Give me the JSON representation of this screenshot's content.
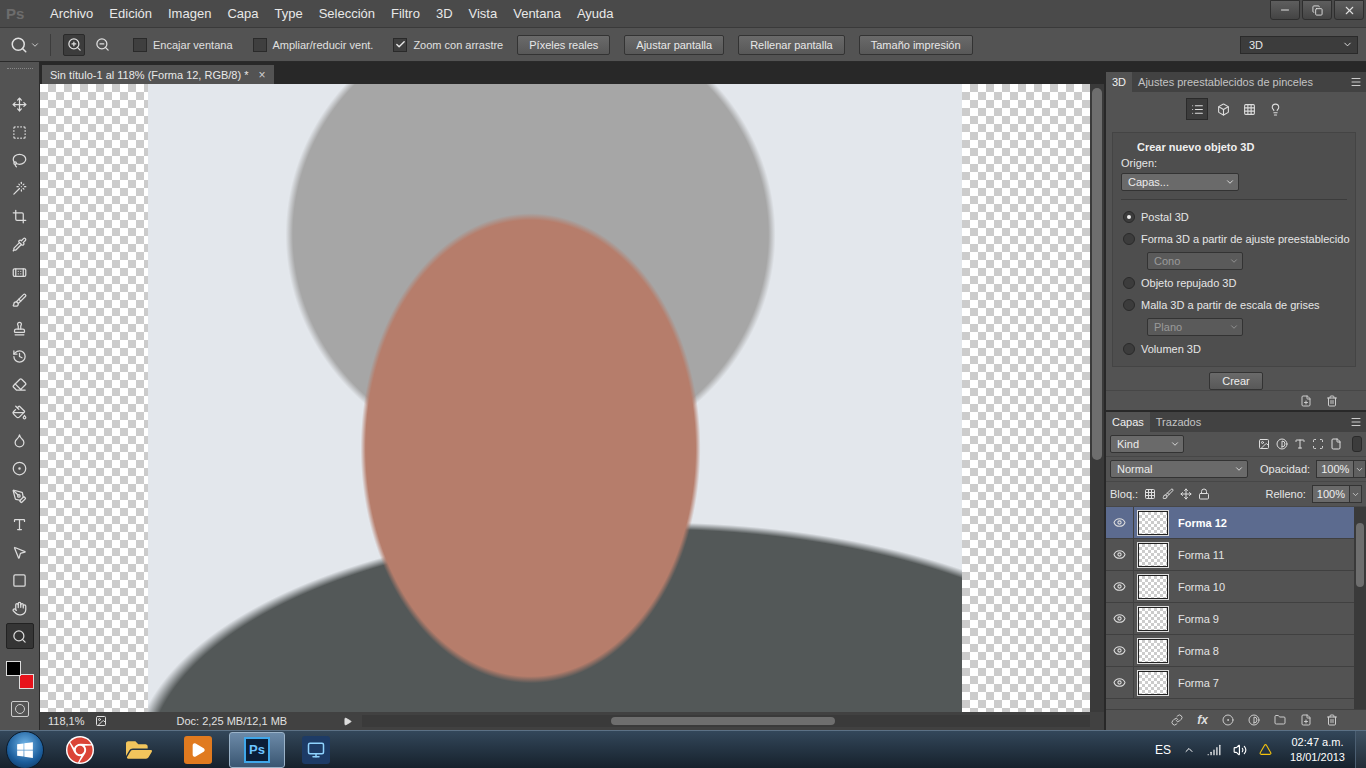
{
  "app": {
    "logo": "Ps"
  },
  "menu": [
    "Archivo",
    "Edición",
    "Imagen",
    "Capa",
    "Type",
    "Selección",
    "Filtro",
    "3D",
    "Vista",
    "Ventana",
    "Ayuda"
  ],
  "options_bar": {
    "zoom_modes": [
      {
        "kind": "in",
        "selected": true
      },
      {
        "kind": "out",
        "selected": false
      }
    ],
    "checkboxes": [
      {
        "label": "Encajar ventana",
        "checked": false
      },
      {
        "label": "Ampliar/reducir vent.",
        "checked": false
      },
      {
        "label": "Zoom con arrastre",
        "checked": true
      }
    ],
    "buttons": [
      "Píxeles reales",
      "Ajustar pantalla",
      "Rellenar pantalla",
      "Tamaño impresión"
    ],
    "workspace": "3D"
  },
  "document": {
    "tab": "Sin título-1 al 118% (Forma 12, RGB/8) *",
    "close": "×"
  },
  "tools": [
    {
      "kind": "move",
      "selected": false
    },
    {
      "kind": "marquee",
      "selected": false
    },
    {
      "kind": "lasso",
      "selected": false
    },
    {
      "kind": "wand",
      "selected": false
    },
    {
      "kind": "crop",
      "selected": false
    },
    {
      "kind": "eyedropper",
      "selected": false
    },
    {
      "kind": "heal",
      "selected": false
    },
    {
      "kind": "brush",
      "selected": false
    },
    {
      "kind": "stamp",
      "selected": false
    },
    {
      "kind": "history",
      "selected": false
    },
    {
      "kind": "eraser",
      "selected": false
    },
    {
      "kind": "bucket",
      "selected": false
    },
    {
      "kind": "blur",
      "selected": false
    },
    {
      "kind": "dodge",
      "selected": false
    },
    {
      "kind": "pen",
      "selected": false
    },
    {
      "kind": "type",
      "selected": false
    },
    {
      "kind": "select",
      "selected": false
    },
    {
      "kind": "shape",
      "selected": false
    },
    {
      "kind": "hand",
      "selected": false
    },
    {
      "kind": "zoom",
      "selected": true
    }
  ],
  "swatches": [
    {
      "color": "#000000"
    },
    {
      "color": "#e8121b"
    }
  ],
  "status_bar": {
    "zoom": "118,1%",
    "doc": "Doc: 2,25 MB/12,1 MB"
  },
  "panel_3d": {
    "tabs": [
      {
        "label": "3D",
        "selected": true
      },
      {
        "label": "Ajustes preestablecidos de pinceles",
        "selected": false
      }
    ],
    "views": [
      {
        "kind": "scene",
        "selected": true
      },
      {
        "kind": "mesh",
        "selected": false
      },
      {
        "kind": "material",
        "selected": false
      },
      {
        "kind": "light",
        "selected": false
      }
    ],
    "title": "Crear nuevo objeto 3D",
    "origin_label": "Origen:",
    "origin": "Capas...",
    "options": [
      {
        "label": "Postal 3D",
        "selected": true
      },
      {
        "label": "Forma 3D a partir de ajuste preestablecido",
        "selected": false,
        "dropdown": {
          "value": "Cono",
          "disabled": true
        }
      },
      {
        "label": "Objeto repujado 3D",
        "selected": false
      },
      {
        "label": "Malla 3D a partir de escala de grises",
        "selected": false,
        "dropdown": {
          "value": "Plano",
          "disabled": true
        }
      },
      {
        "label": "Volumen 3D",
        "selected": false
      }
    ],
    "button": "Crear"
  },
  "layers_panel": {
    "tabs": [
      {
        "label": "Capas",
        "selected": true
      },
      {
        "label": "Trazados",
        "selected": false
      }
    ],
    "filter": "Kind",
    "blend": "Normal",
    "opacity_label": "Opacidad:",
    "opacity": "100%",
    "lock_label": "Bloq.:",
    "fill_label": "Relleno:",
    "fill": "100%",
    "layers": [
      {
        "name": "Forma 12",
        "selected": true,
        "visible": true
      },
      {
        "name": "Forma 11",
        "selected": false,
        "visible": true
      },
      {
        "name": "Forma 10",
        "selected": false,
        "visible": true
      },
      {
        "name": "Forma 9",
        "selected": false,
        "visible": true
      },
      {
        "name": "Forma 8",
        "selected": false,
        "visible": true
      },
      {
        "name": "Forma 7",
        "selected": false,
        "visible": true
      }
    ],
    "fx": "fx"
  },
  "taskbar": {
    "apps": [
      {
        "kind": "chrome",
        "active": false
      },
      {
        "kind": "explorer",
        "active": false
      },
      {
        "kind": "media",
        "active": false
      },
      {
        "kind": "photoshop",
        "active": true
      },
      {
        "kind": "other",
        "active": false
      }
    ],
    "language": "ES",
    "time": "02:47 a.m.",
    "date": "18/01/2013"
  }
}
